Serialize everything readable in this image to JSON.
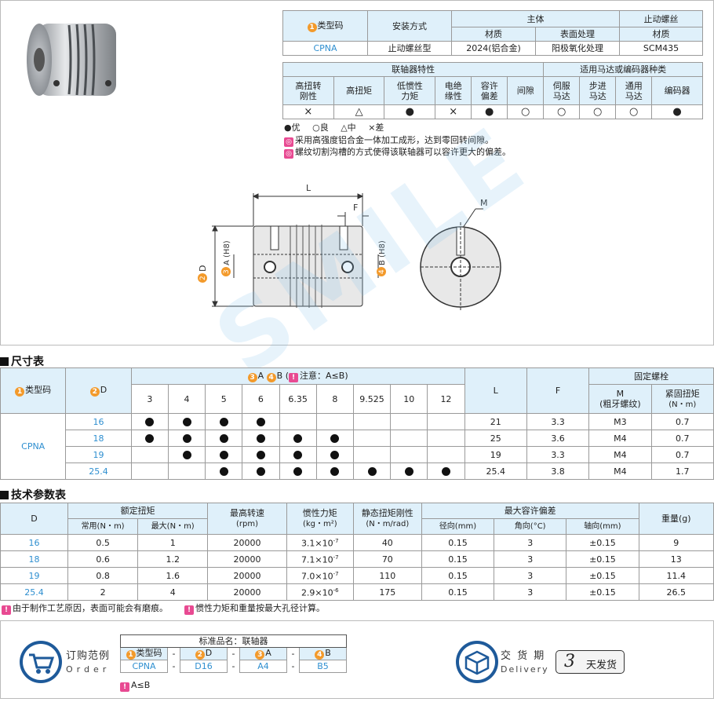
{
  "top_table": {
    "h_code": "类型码",
    "h_install": "安装方式",
    "h_body": "主体",
    "h_screw": "止动螺丝",
    "h_material": "材质",
    "h_surface": "表面处理",
    "h_screw_material": "材质",
    "v_code": "CPNA",
    "v_install": "止动螺丝型",
    "v_material": "2024(铝合金)",
    "v_surface": "阳极氧化处理",
    "v_screw_material": "SCM435"
  },
  "feature_table": {
    "h_features": "联轴器特性",
    "h_motor": "适用马达或编码器种类",
    "cols": [
      {
        "l1": "高扭转",
        "l2": "刚性",
        "v": "×"
      },
      {
        "l1": "高扭矩",
        "l2": "",
        "v": "△"
      },
      {
        "l1": "低惯性",
        "l2": "力矩",
        "v": "●"
      },
      {
        "l1": "电绝",
        "l2": "缘性",
        "v": "×"
      },
      {
        "l1": "容许",
        "l2": "偏差",
        "v": "●"
      },
      {
        "l1": "间隙",
        "l2": "",
        "v": "○"
      },
      {
        "l1": "伺服",
        "l2": "马达",
        "v": "○"
      },
      {
        "l1": "步进",
        "l2": "马达",
        "v": "○"
      },
      {
        "l1": "通用",
        "l2": "马达",
        "v": "○"
      },
      {
        "l1": "编码器",
        "l2": "",
        "v": "●"
      }
    ]
  },
  "legend": {
    "excellent": "●优",
    "good": "○良",
    "medium": "△中",
    "poor": "×差"
  },
  "notes": [
    "采用高强度铝合金一体加工成形，达到零回转间隙。",
    "螺纹切割沟槽的方式使得该联轴器可以容许更大的偏差。"
  ],
  "drawing": {
    "L": "L",
    "F": "F",
    "M": "M",
    "A": "A (H8)",
    "B": "B (H8)",
    "D": "D"
  },
  "size_section": {
    "title": "尺寸表",
    "h_code": "类型码",
    "h_D": "D",
    "h_AB": "A",
    "h_AB2": "B",
    "h_note": "注意：A≤B",
    "h_L": "L",
    "h_F": "F",
    "h_screw": "固定螺栓",
    "h_M1": "M",
    "h_M2": "(粗牙螺纹)",
    "h_T1": "紧固扭矩",
    "h_T2": "(N・m)",
    "bores": [
      "3",
      "4",
      "5",
      "6",
      "6.35",
      "8",
      "9.525",
      "10",
      "12"
    ],
    "code": "CPNA",
    "rows": [
      {
        "D": "16",
        "dots": [
          1,
          1,
          1,
          1,
          0,
          0,
          0,
          0,
          0
        ],
        "L": "21",
        "F": "3.3",
        "M": "M3",
        "T": "0.7"
      },
      {
        "D": "18",
        "dots": [
          1,
          1,
          1,
          1,
          1,
          1,
          0,
          0,
          0
        ],
        "L": "25",
        "F": "3.6",
        "M": "M4",
        "T": "0.7"
      },
      {
        "D": "19",
        "dots": [
          0,
          1,
          1,
          1,
          1,
          1,
          0,
          0,
          0
        ],
        "L": "19",
        "F": "3.3",
        "M": "M4",
        "T": "0.7"
      },
      {
        "D": "25.4",
        "dots": [
          0,
          0,
          1,
          1,
          1,
          1,
          1,
          1,
          1
        ],
        "L": "25.4",
        "F": "3.8",
        "M": "M4",
        "T": "1.7"
      }
    ]
  },
  "tech_section": {
    "title": "技术参数表",
    "h_D": "D",
    "h_torque": "额定扭矩",
    "h_t_normal": "常用(N・m)",
    "h_t_max": "最大(N・m)",
    "h_speed1": "最高转速",
    "h_speed2": "(rpm)",
    "h_inertia1": "惯性力矩",
    "h_inertia2": "(kg・m²)",
    "h_stiff1": "静态扭矩刚性",
    "h_stiff2": "(N・m/rad)",
    "h_mis": "最大容许偏差",
    "h_radial": "径向(mm)",
    "h_angle": "角向(°C)",
    "h_axial": "轴向(mm)",
    "h_weight": "重量(g)",
    "rows": [
      {
        "D": "16",
        "tn": "0.5",
        "tm": "1",
        "rpm": "20000",
        "in_base": "3.1×10",
        "in_exp": "-7",
        "st": "40",
        "rad": "0.15",
        "ang": "3",
        "ax": "±0.15",
        "w": "9"
      },
      {
        "D": "18",
        "tn": "0.6",
        "tm": "1.2",
        "rpm": "20000",
        "in_base": "7.1×10",
        "in_exp": "-7",
        "st": "70",
        "rad": "0.15",
        "ang": "3",
        "ax": "±0.15",
        "w": "13"
      },
      {
        "D": "19",
        "tn": "0.8",
        "tm": "1.6",
        "rpm": "20000",
        "in_base": "7.0×10",
        "in_exp": "-7",
        "st": "110",
        "rad": "0.15",
        "ang": "3",
        "ax": "±0.15",
        "w": "11.4"
      },
      {
        "D": "25.4",
        "tn": "2",
        "tm": "4",
        "rpm": "20000",
        "in_base": "2.9×10",
        "in_exp": "-6",
        "st": "175",
        "rad": "0.15",
        "ang": "3",
        "ax": "±0.15",
        "w": "26.5"
      }
    ],
    "note1": "由于制作工艺原因，表面可能会有磨痕。",
    "note2": "惯性力矩和重量按最大孔径计算。"
  },
  "order": {
    "label_cn": "订购范例",
    "label_en": "Order",
    "std_name": "标准品名：联轴器",
    "h_code": "类型码",
    "h_D": "D",
    "h_A": "A",
    "h_B": "B",
    "dash": "-",
    "v_code": "CPNA",
    "v_D": "D16",
    "v_A": "A4",
    "v_B": "B5",
    "note": "A≤B"
  },
  "delivery": {
    "label_cn": "交 货 期",
    "label_en": "Delivery",
    "days": "3",
    "text": "天发货"
  },
  "watermark": "SMILE"
}
